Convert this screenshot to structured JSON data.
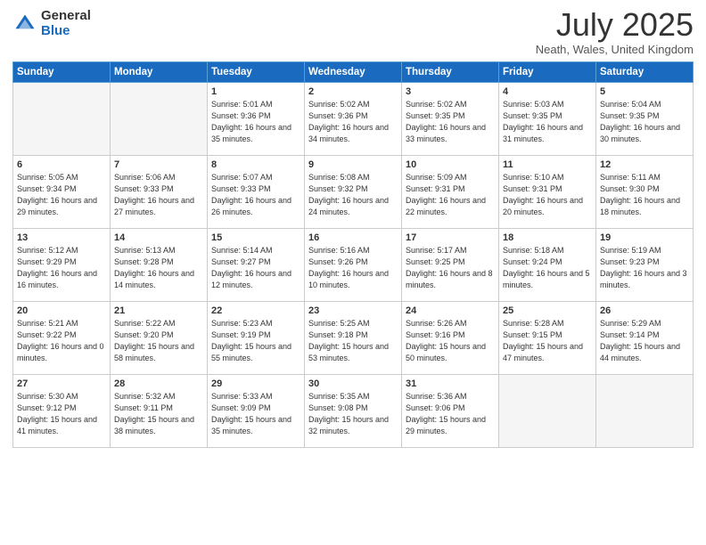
{
  "header": {
    "logo_general": "General",
    "logo_blue": "Blue",
    "month_title": "July 2025",
    "location": "Neath, Wales, United Kingdom"
  },
  "days_of_week": [
    "Sunday",
    "Monday",
    "Tuesday",
    "Wednesday",
    "Thursday",
    "Friday",
    "Saturday"
  ],
  "weeks": [
    [
      {
        "day": "",
        "sunrise": "",
        "sunset": "",
        "daylight": ""
      },
      {
        "day": "",
        "sunrise": "",
        "sunset": "",
        "daylight": ""
      },
      {
        "day": "1",
        "sunrise": "Sunrise: 5:01 AM",
        "sunset": "Sunset: 9:36 PM",
        "daylight": "Daylight: 16 hours and 35 minutes."
      },
      {
        "day": "2",
        "sunrise": "Sunrise: 5:02 AM",
        "sunset": "Sunset: 9:36 PM",
        "daylight": "Daylight: 16 hours and 34 minutes."
      },
      {
        "day": "3",
        "sunrise": "Sunrise: 5:02 AM",
        "sunset": "Sunset: 9:35 PM",
        "daylight": "Daylight: 16 hours and 33 minutes."
      },
      {
        "day": "4",
        "sunrise": "Sunrise: 5:03 AM",
        "sunset": "Sunset: 9:35 PM",
        "daylight": "Daylight: 16 hours and 31 minutes."
      },
      {
        "day": "5",
        "sunrise": "Sunrise: 5:04 AM",
        "sunset": "Sunset: 9:35 PM",
        "daylight": "Daylight: 16 hours and 30 minutes."
      }
    ],
    [
      {
        "day": "6",
        "sunrise": "Sunrise: 5:05 AM",
        "sunset": "Sunset: 9:34 PM",
        "daylight": "Daylight: 16 hours and 29 minutes."
      },
      {
        "day": "7",
        "sunrise": "Sunrise: 5:06 AM",
        "sunset": "Sunset: 9:33 PM",
        "daylight": "Daylight: 16 hours and 27 minutes."
      },
      {
        "day": "8",
        "sunrise": "Sunrise: 5:07 AM",
        "sunset": "Sunset: 9:33 PM",
        "daylight": "Daylight: 16 hours and 26 minutes."
      },
      {
        "day": "9",
        "sunrise": "Sunrise: 5:08 AM",
        "sunset": "Sunset: 9:32 PM",
        "daylight": "Daylight: 16 hours and 24 minutes."
      },
      {
        "day": "10",
        "sunrise": "Sunrise: 5:09 AM",
        "sunset": "Sunset: 9:31 PM",
        "daylight": "Daylight: 16 hours and 22 minutes."
      },
      {
        "day": "11",
        "sunrise": "Sunrise: 5:10 AM",
        "sunset": "Sunset: 9:31 PM",
        "daylight": "Daylight: 16 hours and 20 minutes."
      },
      {
        "day": "12",
        "sunrise": "Sunrise: 5:11 AM",
        "sunset": "Sunset: 9:30 PM",
        "daylight": "Daylight: 16 hours and 18 minutes."
      }
    ],
    [
      {
        "day": "13",
        "sunrise": "Sunrise: 5:12 AM",
        "sunset": "Sunset: 9:29 PM",
        "daylight": "Daylight: 16 hours and 16 minutes."
      },
      {
        "day": "14",
        "sunrise": "Sunrise: 5:13 AM",
        "sunset": "Sunset: 9:28 PM",
        "daylight": "Daylight: 16 hours and 14 minutes."
      },
      {
        "day": "15",
        "sunrise": "Sunrise: 5:14 AM",
        "sunset": "Sunset: 9:27 PM",
        "daylight": "Daylight: 16 hours and 12 minutes."
      },
      {
        "day": "16",
        "sunrise": "Sunrise: 5:16 AM",
        "sunset": "Sunset: 9:26 PM",
        "daylight": "Daylight: 16 hours and 10 minutes."
      },
      {
        "day": "17",
        "sunrise": "Sunrise: 5:17 AM",
        "sunset": "Sunset: 9:25 PM",
        "daylight": "Daylight: 16 hours and 8 minutes."
      },
      {
        "day": "18",
        "sunrise": "Sunrise: 5:18 AM",
        "sunset": "Sunset: 9:24 PM",
        "daylight": "Daylight: 16 hours and 5 minutes."
      },
      {
        "day": "19",
        "sunrise": "Sunrise: 5:19 AM",
        "sunset": "Sunset: 9:23 PM",
        "daylight": "Daylight: 16 hours and 3 minutes."
      }
    ],
    [
      {
        "day": "20",
        "sunrise": "Sunrise: 5:21 AM",
        "sunset": "Sunset: 9:22 PM",
        "daylight": "Daylight: 16 hours and 0 minutes."
      },
      {
        "day": "21",
        "sunrise": "Sunrise: 5:22 AM",
        "sunset": "Sunset: 9:20 PM",
        "daylight": "Daylight: 15 hours and 58 minutes."
      },
      {
        "day": "22",
        "sunrise": "Sunrise: 5:23 AM",
        "sunset": "Sunset: 9:19 PM",
        "daylight": "Daylight: 15 hours and 55 minutes."
      },
      {
        "day": "23",
        "sunrise": "Sunrise: 5:25 AM",
        "sunset": "Sunset: 9:18 PM",
        "daylight": "Daylight: 15 hours and 53 minutes."
      },
      {
        "day": "24",
        "sunrise": "Sunrise: 5:26 AM",
        "sunset": "Sunset: 9:16 PM",
        "daylight": "Daylight: 15 hours and 50 minutes."
      },
      {
        "day": "25",
        "sunrise": "Sunrise: 5:28 AM",
        "sunset": "Sunset: 9:15 PM",
        "daylight": "Daylight: 15 hours and 47 minutes."
      },
      {
        "day": "26",
        "sunrise": "Sunrise: 5:29 AM",
        "sunset": "Sunset: 9:14 PM",
        "daylight": "Daylight: 15 hours and 44 minutes."
      }
    ],
    [
      {
        "day": "27",
        "sunrise": "Sunrise: 5:30 AM",
        "sunset": "Sunset: 9:12 PM",
        "daylight": "Daylight: 15 hours and 41 minutes."
      },
      {
        "day": "28",
        "sunrise": "Sunrise: 5:32 AM",
        "sunset": "Sunset: 9:11 PM",
        "daylight": "Daylight: 15 hours and 38 minutes."
      },
      {
        "day": "29",
        "sunrise": "Sunrise: 5:33 AM",
        "sunset": "Sunset: 9:09 PM",
        "daylight": "Daylight: 15 hours and 35 minutes."
      },
      {
        "day": "30",
        "sunrise": "Sunrise: 5:35 AM",
        "sunset": "Sunset: 9:08 PM",
        "daylight": "Daylight: 15 hours and 32 minutes."
      },
      {
        "day": "31",
        "sunrise": "Sunrise: 5:36 AM",
        "sunset": "Sunset: 9:06 PM",
        "daylight": "Daylight: 15 hours and 29 minutes."
      },
      {
        "day": "",
        "sunrise": "",
        "sunset": "",
        "daylight": ""
      },
      {
        "day": "",
        "sunrise": "",
        "sunset": "",
        "daylight": ""
      }
    ]
  ]
}
